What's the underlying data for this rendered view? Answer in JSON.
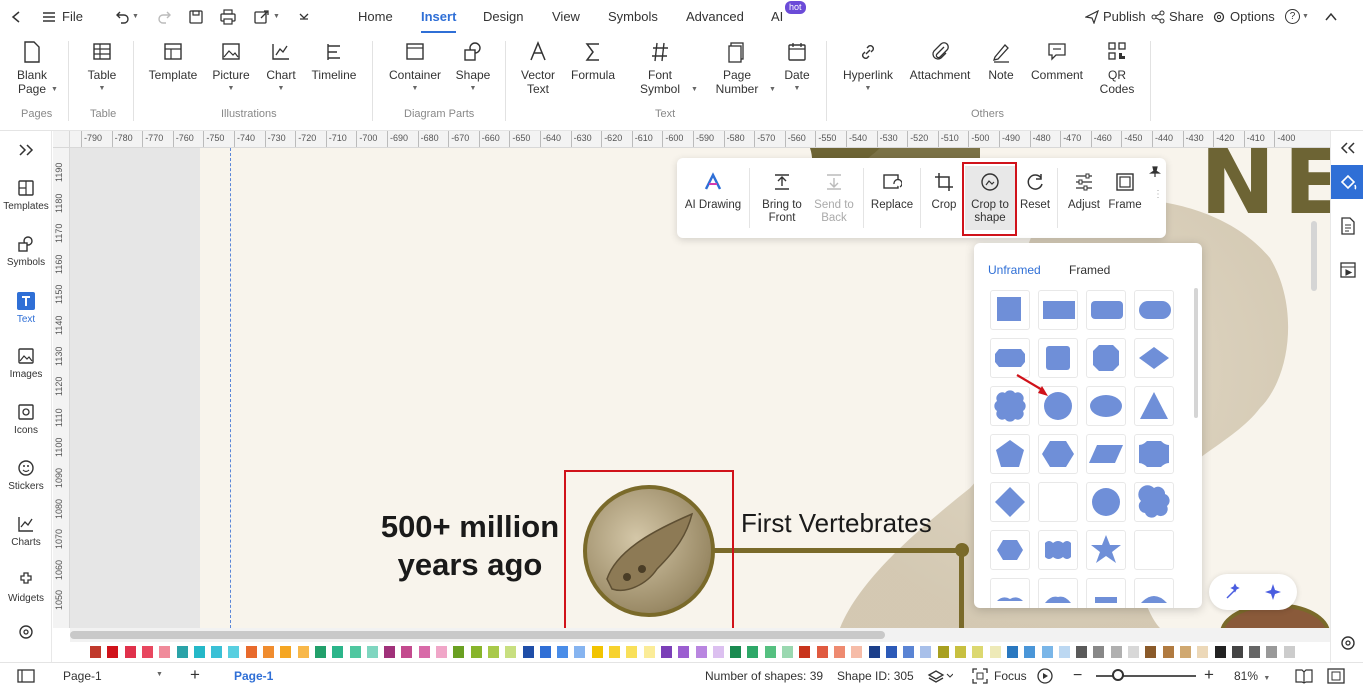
{
  "topbar": {
    "file_label": "File",
    "menu_tabs": [
      "Home",
      "Insert",
      "Design",
      "View",
      "Symbols",
      "Advanced",
      "AI"
    ],
    "hot_badge": "hot",
    "publish_label": "Publish",
    "share_label": "Share",
    "options_label": "Options",
    "help_label": "?"
  },
  "ribbon": {
    "buttons": {
      "blank_page": "Blank\nPage",
      "table": "Table",
      "template": "Template",
      "picture": "Picture",
      "chart": "Chart",
      "timeline": "Timeline",
      "container": "Container",
      "shape": "Shape",
      "vector_text": "Vector\nText",
      "formula": "Formula",
      "font_symbol": "Font\nSymbol",
      "page_number": "Page\nNumber",
      "date": "Date",
      "hyperlink": "Hyperlink",
      "attachment": "Attachment",
      "note": "Note",
      "comment": "Comment",
      "qr_codes": "QR\nCodes"
    },
    "groups": {
      "pages": "Pages",
      "table": "Table",
      "illustrations": "Illustrations",
      "diagram_parts": "Diagram Parts",
      "text": "Text",
      "others": "Others"
    }
  },
  "leftbar": {
    "items": [
      "Templates",
      "Symbols",
      "Text",
      "Images",
      "Icons",
      "Stickers",
      "Charts",
      "Widgets"
    ]
  },
  "ruler": {
    "h_ticks": [
      "-790",
      "-780",
      "-770",
      "-760",
      "-750",
      "-740",
      "-730",
      "-720",
      "-710",
      "-700",
      "-690",
      "-680",
      "-670",
      "-660",
      "-650",
      "-640",
      "-630",
      "-620",
      "-610",
      "-600",
      "-590",
      "-580",
      "-570",
      "-560",
      "-550",
      "-540",
      "-530",
      "-520",
      "-510",
      "-500",
      "-490",
      "-480",
      "-470",
      "-460",
      "-450",
      "-440",
      "-430",
      "-420",
      "-410",
      "-400"
    ],
    "v_ticks": [
      "1190",
      "1180",
      "1170",
      "1160",
      "1150",
      "1140",
      "1130",
      "1120",
      "1110",
      "1100",
      "1090",
      "1080",
      "1070",
      "1060",
      "1050"
    ]
  },
  "canvas": {
    "era_line1": "500+ million",
    "era_line2": "years ago",
    "event_label": "First Vertebrates",
    "title_fragment": "NE"
  },
  "context_toolbar": {
    "ai_drawing": "AI Drawing",
    "bring_to_front": "Bring to\nFront",
    "send_to_back": "Send to\nBack",
    "replace": "Replace",
    "crop": "Crop",
    "crop_to_shape": "Crop to\nshape",
    "reset": "Reset",
    "adjust": "Adjust",
    "frame": "Frame"
  },
  "shapes_panel": {
    "tab_unframed": "Unframed",
    "tab_framed": "Framed",
    "active_tab": "Unframed",
    "shape_color": "#6f8fd8"
  },
  "statusbar": {
    "page_selector": "Page-1",
    "page_tab": "Page-1",
    "shape_count": "Number of shapes: 39",
    "shape_id": "Shape ID: 305",
    "focus_label": "Focus",
    "zoom": "81%"
  },
  "colors": {
    "accent": "#2f6fd6",
    "highlight_red": "#d0121a",
    "timeline_olive": "#7a6a2a"
  },
  "palette": [
    "#c0392b",
    "#d0121a",
    "#e0314b",
    "#e8475f",
    "#f08a9a",
    "#2aa3a8",
    "#24b8c8",
    "#3ac0d6",
    "#58cfe0",
    "#e86a2c",
    "#f08c2e",
    "#f5a623",
    "#f8b84a",
    "#22a06b",
    "#2bb58a",
    "#4fc7a0",
    "#7fd6c0",
    "#a0317a",
    "#c34a8e",
    "#d86aa8",
    "#f0a6c8",
    "#6aa022",
    "#88b52b",
    "#a8c94a",
    "#c8df80",
    "#1f4ea8",
    "#2f6fd6",
    "#4a8de8",
    "#86b4f0",
    "#f2c400",
    "#f7d22e",
    "#f9e05a",
    "#fbec98",
    "#7b3fb8",
    "#9b5ed0",
    "#b986e0",
    "#dcc0f0",
    "#1a8a50",
    "#2ea868",
    "#55c080",
    "#9ad8b0",
    "#c8341c",
    "#e05a40",
    "#ee8a70",
    "#f6bca8",
    "#1c3f8a",
    "#2c5ab8",
    "#5a84d4",
    "#a8c0ea",
    "#a8a020",
    "#c8c040",
    "#dcd870",
    "#eeeab8",
    "#2a78c0",
    "#4a96d8",
    "#7ab6e8",
    "#bcd8f2",
    "#5a5a5a",
    "#888888",
    "#b0b0b0",
    "#d8d8d8",
    "#8a5a2a",
    "#b07a40",
    "#d0a870",
    "#ecd8b8",
    "#222222",
    "#444444",
    "#666666",
    "#999999",
    "#cccccc"
  ]
}
